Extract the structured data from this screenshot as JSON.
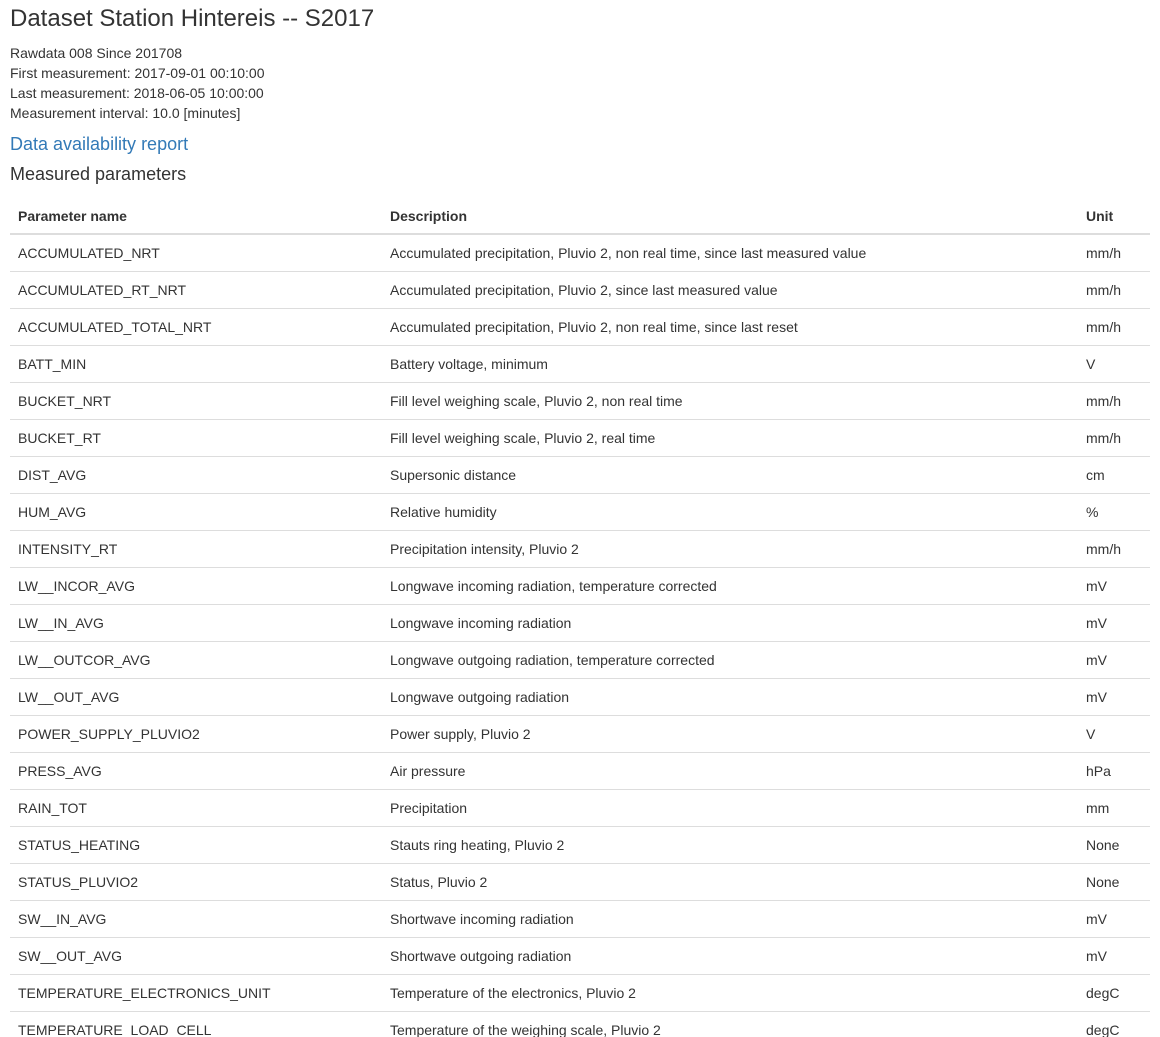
{
  "page": {
    "title": "Dataset Station Hintereis -- S2017",
    "meta": {
      "rawdata": "Rawdata 008 Since 201708",
      "first_measurement": "First measurement: 2017-09-01 00:10:00",
      "last_measurement": "Last measurement: 2018-06-05 10:00:00",
      "interval": "Measurement interval: 10.0 [minutes]"
    },
    "report_link": "Data availability report",
    "section_title": "Measured parameters"
  },
  "table": {
    "headers": {
      "name": "Parameter name",
      "description": "Description",
      "unit": "Unit"
    },
    "rows": [
      {
        "name": "ACCUMULATED_NRT",
        "description": "Accumulated precipitation, Pluvio 2, non real time, since last measured value",
        "unit": "mm/h"
      },
      {
        "name": "ACCUMULATED_RT_NRT",
        "description": "Accumulated precipitation, Pluvio 2, since last measured value",
        "unit": "mm/h"
      },
      {
        "name": "ACCUMULATED_TOTAL_NRT",
        "description": "Accumulated precipitation, Pluvio 2, non real time, since last reset",
        "unit": "mm/h"
      },
      {
        "name": "BATT_MIN",
        "description": "Battery voltage, minimum",
        "unit": "V"
      },
      {
        "name": "BUCKET_NRT",
        "description": "Fill level weighing scale, Pluvio 2, non real time",
        "unit": "mm/h"
      },
      {
        "name": "BUCKET_RT",
        "description": "Fill level weighing scale, Pluvio 2, real time",
        "unit": "mm/h"
      },
      {
        "name": "DIST_AVG",
        "description": "Supersonic distance",
        "unit": "cm"
      },
      {
        "name": "HUM_AVG",
        "description": "Relative humidity",
        "unit": "%"
      },
      {
        "name": "INTENSITY_RT",
        "description": "Precipitation intensity, Pluvio 2",
        "unit": "mm/h"
      },
      {
        "name": "LW__INCOR_AVG",
        "description": "Longwave incoming radiation, temperature corrected",
        "unit": "mV"
      },
      {
        "name": "LW__IN_AVG",
        "description": "Longwave incoming radiation",
        "unit": "mV"
      },
      {
        "name": "LW__OUTCOR_AVG",
        "description": "Longwave outgoing radiation, temperature corrected",
        "unit": "mV"
      },
      {
        "name": "LW__OUT_AVG",
        "description": "Longwave outgoing radiation",
        "unit": "mV"
      },
      {
        "name": "POWER_SUPPLY_PLUVIO2",
        "description": "Power supply, Pluvio 2",
        "unit": "V"
      },
      {
        "name": "PRESS_AVG",
        "description": "Air pressure",
        "unit": "hPa"
      },
      {
        "name": "RAIN_TOT",
        "description": "Precipitation",
        "unit": "mm"
      },
      {
        "name": "STATUS_HEATING",
        "description": "Stauts ring heating, Pluvio 2",
        "unit": "None"
      },
      {
        "name": "STATUS_PLUVIO2",
        "description": "Status, Pluvio 2",
        "unit": "None"
      },
      {
        "name": "SW__IN_AVG",
        "description": "Shortwave incoming radiation",
        "unit": "mV"
      },
      {
        "name": "SW__OUT_AVG",
        "description": "Shortwave outgoing radiation",
        "unit": "mV"
      },
      {
        "name": "TEMPERATURE_ELECTRONICS_UNIT",
        "description": "Temperature of the electronics, Pluvio 2",
        "unit": "degC"
      },
      {
        "name": "TEMPERATURE_LOAD_CELL",
        "description": "Temperature of the weighing scale, Pluvio 2",
        "unit": "degC"
      }
    ]
  },
  "colors": {
    "link": "#337ab7",
    "text": "#333333",
    "border": "#dddddd"
  }
}
